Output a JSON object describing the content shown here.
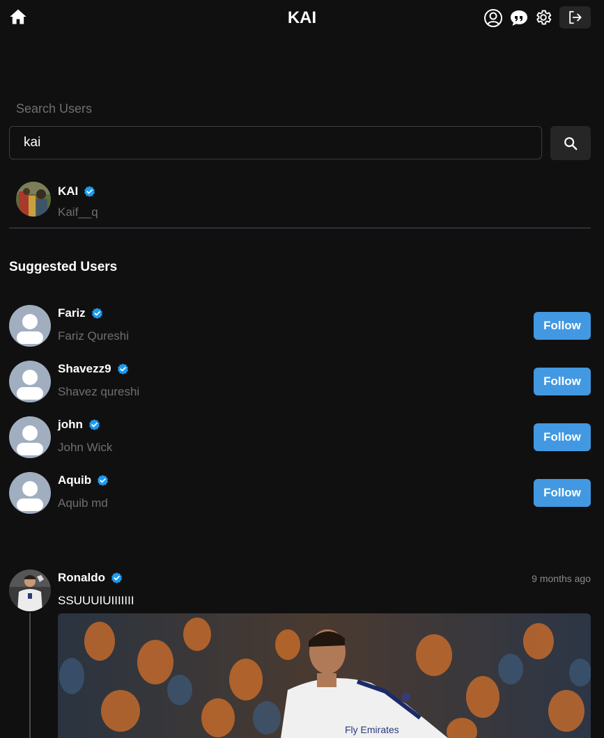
{
  "header": {
    "title": "KAI",
    "icons": [
      "home-icon",
      "profile-icon",
      "chat-icon",
      "settings-icon",
      "logout-icon"
    ]
  },
  "search": {
    "label": "Search Users",
    "value": "kai",
    "button_icon": "search-icon"
  },
  "result": {
    "username": "KAI",
    "name": "Kaif__q",
    "verified": true
  },
  "suggested": {
    "title": "Suggested Users",
    "follow_label": "Follow",
    "users": [
      {
        "username": "Fariz",
        "name": "Fariz Qureshi",
        "verified": true
      },
      {
        "username": "Shavezz9",
        "name": "Shavez qureshi",
        "verified": true
      },
      {
        "username": "john",
        "name": "John Wick",
        "verified": true
      },
      {
        "username": "Aquib",
        "name": "Aquib md",
        "verified": true
      }
    ]
  },
  "post": {
    "username": "Ronaldo",
    "verified": true,
    "time": "9 months ago",
    "text": "SSUUUIUIIIIIII"
  },
  "colors": {
    "background": "#101010",
    "accent": "#4299e1",
    "verified": "#1d9bf0",
    "muted": "#6f6f6f",
    "avatar_placeholder": "#a0aec0"
  }
}
